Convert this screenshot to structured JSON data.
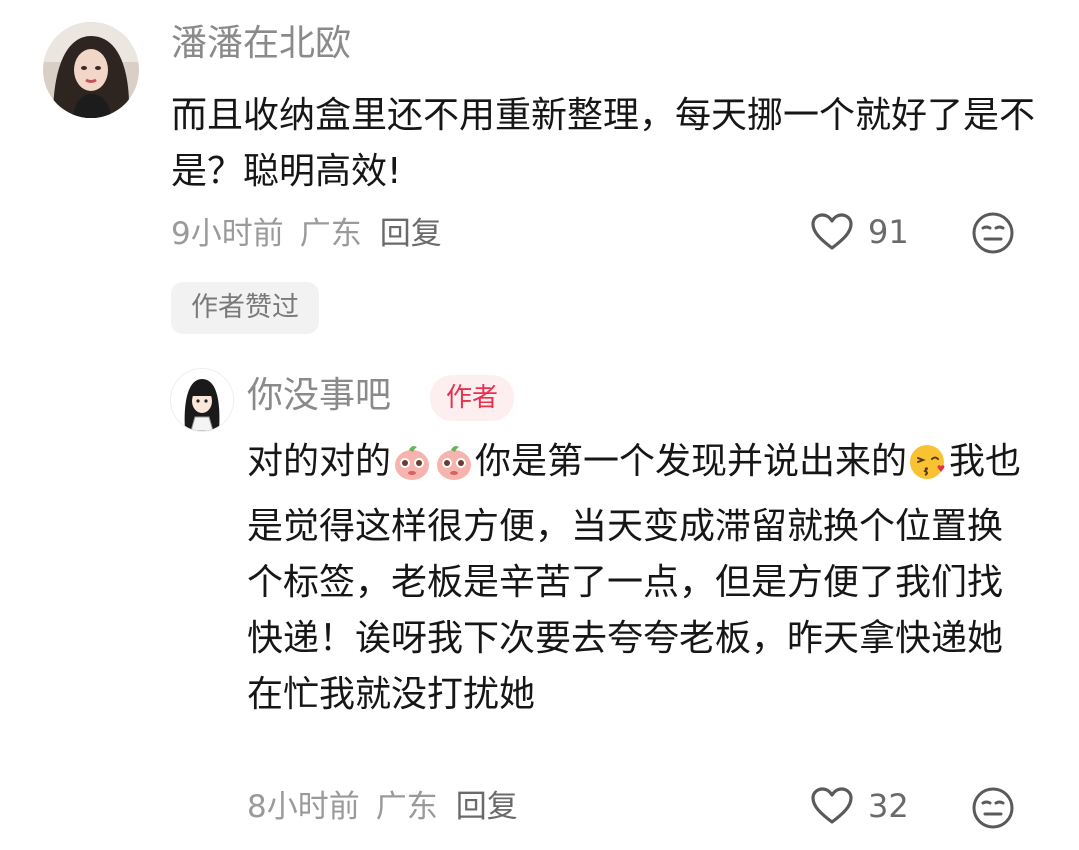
{
  "comment": {
    "username": "潘潘在北欧",
    "text": "而且收纳盒里还不用重新整理，每天挪一个就好了是不是？聪明高效!",
    "time": "9小时前",
    "location": "广东",
    "reply_label": "回复",
    "likes": "91",
    "author_liked_badge": "作者赞过"
  },
  "reply": {
    "username": "你没事吧",
    "author_badge": "作者",
    "text_part1": "对的对的",
    "text_part2": "你是第一个发现并说出来的",
    "text_part3": "我也是觉得这样很方便，当天变成滞留就换个位置换个标签，老板是辛苦了一点，但是方便了我们找快递！诶呀我下次要去夸夸老板，昨天拿快递她在忙我就没打扰她",
    "time": "8小时前",
    "location": "广东",
    "reply_label": "回复",
    "likes": "32"
  },
  "icons": {
    "like": "heart-outline-icon",
    "emoji_reaction": "neutral-face-icon",
    "inline_emoji_1": "peach-sticker-emoji",
    "inline_emoji_2": "peach-sticker-emoji",
    "inline_emoji_3": "kissing-face-emoji"
  },
  "colors": {
    "author_badge_text": "#e8314e",
    "author_badge_bg": "#fdeef0",
    "username": "#8a8a8a",
    "meta": "#9a9a9a"
  }
}
